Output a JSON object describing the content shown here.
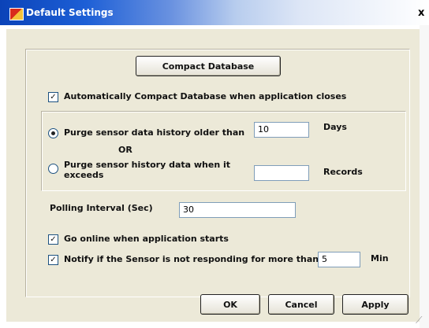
{
  "window": {
    "title": "Default Settings",
    "close_symbol": "x",
    "icon": "app-icon"
  },
  "compact": {
    "button_label": "Compact Database",
    "auto_compact_label": "Automatically Compact Database when application closes",
    "auto_compact_checked": true
  },
  "purge": {
    "by_age_label": "Purge sensor data history older than",
    "by_age_selected": true,
    "age_value": "10",
    "age_unit": "Days",
    "or_label": "OR",
    "by_count_label_line1": "Purge sensor history data when it",
    "by_count_label_line2": "exceeds",
    "by_count_selected": false,
    "count_value": "",
    "count_unit": "Records"
  },
  "polling": {
    "label": "Polling Interval (Sec)",
    "value": "30"
  },
  "online": {
    "label": "Go online when application starts",
    "checked": true
  },
  "notify": {
    "label": "Notify if the Sensor is not responding for more than",
    "checked": true,
    "value": "5",
    "unit": "Min"
  },
  "footer": {
    "ok_label": "OK",
    "cancel_label": "Cancel",
    "apply_label": "Apply"
  },
  "colors": {
    "dialog_bg": "#ece9d8",
    "title_gradient_start": "#0b43b8",
    "field_border": "#7f9db9"
  }
}
